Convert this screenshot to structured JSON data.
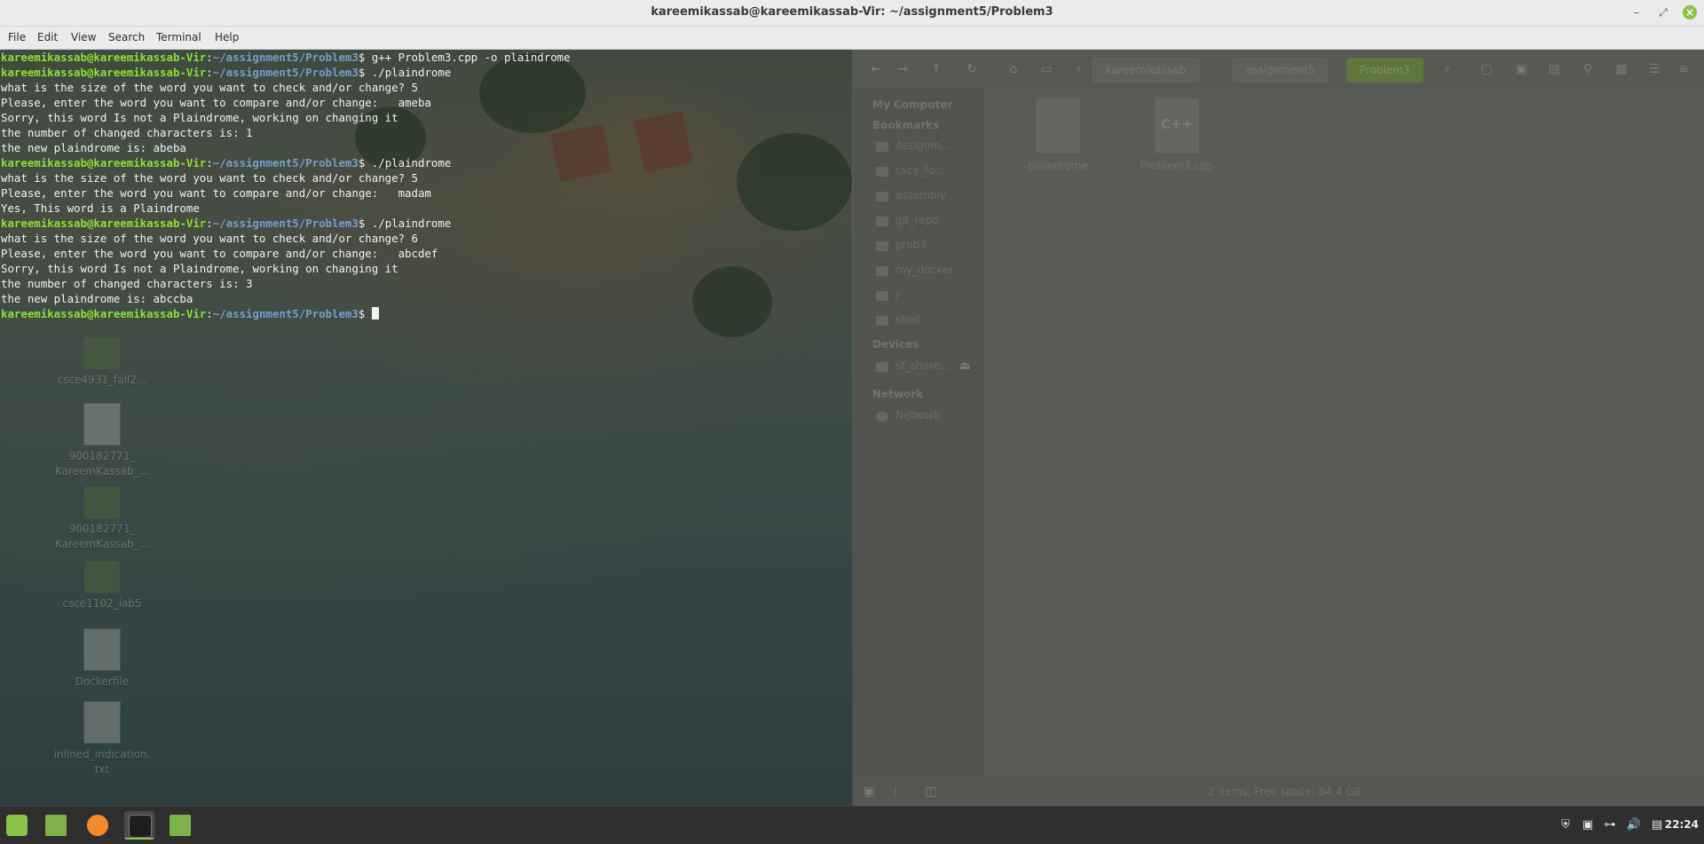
{
  "window": {
    "title": "kareemikassab@kareemikassab-Vir: ~/assignment5/Problem3",
    "controls": [
      "minimize-icon",
      "maximize-icon",
      "close-icon"
    ]
  },
  "menu": [
    "File",
    "Edit",
    "View",
    "Search",
    "Terminal",
    "Help"
  ],
  "terminal": {
    "prompt_user": "kareemikassab@kareemikassab-Vir",
    "prompt_path": "~/assignment5/Problem3",
    "lines": [
      {
        "type": "cmd",
        "text": "$ g++ Problem3.cpp -o plaindrome"
      },
      {
        "type": "cmd",
        "text": "$ ./plaindrome"
      },
      {
        "type": "out",
        "text": "what is the size of the word you want to check and/or change? 5"
      },
      {
        "type": "out",
        "text": "Please, enter the word you want to compare and/or change:   ameba"
      },
      {
        "type": "out",
        "text": "Sorry, this word Is not a Plaindrome, working on changing it"
      },
      {
        "type": "out",
        "text": "the number of changed characters is: 1"
      },
      {
        "type": "out",
        "text": "the new plaindrome is: abeba"
      },
      {
        "type": "cmd",
        "text": "$ ./plaindrome"
      },
      {
        "type": "out",
        "text": "what is the size of the word you want to check and/or change? 5"
      },
      {
        "type": "out",
        "text": "Please, enter the word you want to compare and/or change:   madam"
      },
      {
        "type": "out",
        "text": "Yes, This word is a Plaindrome"
      },
      {
        "type": "cmd",
        "text": "$ ./plaindrome"
      },
      {
        "type": "out",
        "text": "what is the size of the word you want to check and/or change? 6"
      },
      {
        "type": "out",
        "text": "Please, enter the word you want to compare and/or change:   abcdef"
      },
      {
        "type": "out",
        "text": "Sorry, this word Is not a Plaindrome, working on changing it"
      },
      {
        "type": "out",
        "text": "the number of changed characters is: 3"
      },
      {
        "type": "out",
        "text": "the new plaindrome is: abccba"
      },
      {
        "type": "prompt",
        "text": "$ "
      }
    ]
  },
  "desktop_icons": [
    {
      "label": "csce4931_fall2...",
      "icon": "folder-icon"
    },
    {
      "label": "900182771_ KareemKassab_...",
      "icon": "document-icon"
    },
    {
      "label": "900182771_ KareemKassab_...",
      "icon": "folder-icon"
    },
    {
      "label": "csce1102_lab5",
      "icon": "folder-icon"
    },
    {
      "label": "Dockerfile",
      "icon": "document-icon"
    },
    {
      "label": "inlined_indication. txt",
      "icon": "document-icon"
    }
  ],
  "file_manager": {
    "breadcrumbs": [
      "kareemikassab",
      "assignment5",
      "Problem3"
    ],
    "sidebar": {
      "my_computer": "My Computer",
      "bookmarks_header": "Bookmarks",
      "bookmarks": [
        "Assignm...",
        "csce_fo...",
        "assembly",
        "git_repo",
        "prob3",
        "my_docker",
        "/",
        "shell"
      ],
      "devices_header": "Devices",
      "devices": [
        "sf_share..."
      ],
      "network_header": "Network",
      "network": [
        "Network"
      ]
    },
    "files": [
      {
        "name": "plaindrome",
        "icon": "executable-file-icon",
        "badge": ""
      },
      {
        "name": "Problem3.cpp",
        "icon": "cpp-file-icon",
        "badge": "C++"
      }
    ],
    "status": "2 items, Free space: 84.4 GB"
  },
  "taskbar": {
    "launchers": [
      {
        "name": "mint-menu-icon",
        "color": "#8cc14c"
      },
      {
        "name": "files-icon",
        "color": "#7fb14a"
      },
      {
        "name": "firefox-icon",
        "color": "#f38b2c"
      },
      {
        "name": "terminal-icon",
        "color": "#1e1e1e"
      },
      {
        "name": "files-icon",
        "color": "#7fb14a"
      }
    ],
    "tray": [
      "shield-icon",
      "network-manager-icon",
      "network-icon",
      "volume-icon",
      "clipboard-icon"
    ],
    "clock": "22:24"
  }
}
